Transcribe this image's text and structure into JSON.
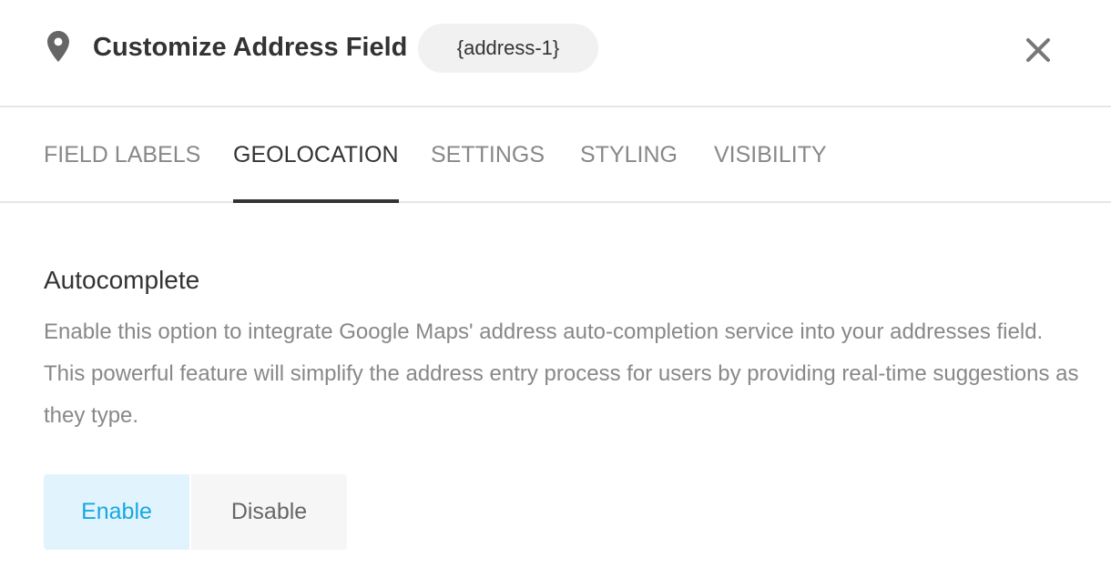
{
  "header": {
    "icon": "map-pin-icon",
    "title": "Customize Address Field",
    "tag": "{address-1}",
    "close_icon": "close-icon"
  },
  "tabs": [
    {
      "label": "FIELD LABELS",
      "active": false
    },
    {
      "label": "GEOLOCATION",
      "active": true
    },
    {
      "label": "SETTINGS",
      "active": false
    },
    {
      "label": "STYLING",
      "active": false
    },
    {
      "label": "VISIBILITY",
      "active": false
    }
  ],
  "section": {
    "title": "Autocomplete",
    "description": "Enable this option to integrate Google Maps' address auto-completion service into your addresses field. This powerful feature will simplify the address entry process for users by providing real-time suggestions as they type."
  },
  "toggle": {
    "enable_label": "Enable",
    "disable_label": "Disable",
    "selected": "Enable"
  },
  "colors": {
    "accent": "#17a8e3",
    "accent_bg": "#e1f4fd",
    "text_dark": "#333333",
    "text_muted": "#888888",
    "border": "#e6e6e6"
  }
}
